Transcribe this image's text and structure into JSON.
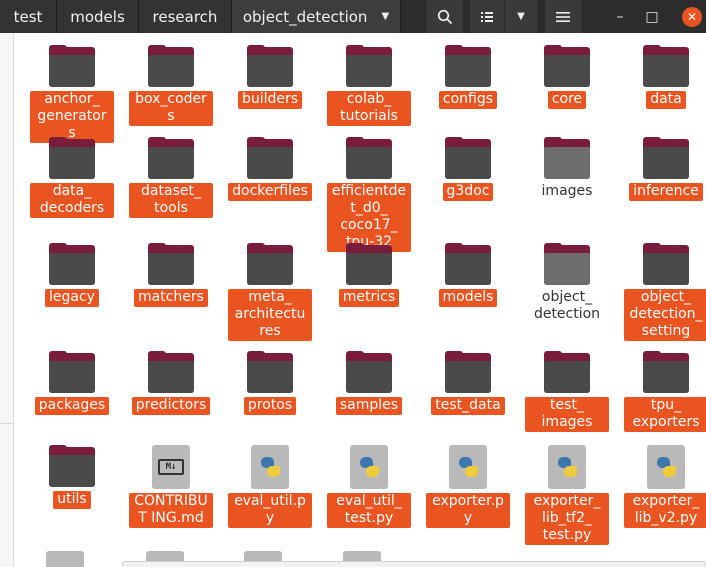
{
  "breadcrumbs": [
    "test",
    "models",
    "research",
    "object_detection"
  ],
  "toolbar": {
    "search_icon": "search-icon",
    "view_icon": "list-view-icon",
    "dropdown_icon": "chevron-down-icon",
    "menu_icon": "hamburger-menu-icon"
  },
  "window": {
    "minimize": "–",
    "maximize": "□",
    "close": "✕"
  },
  "colors": {
    "accent": "#e95420",
    "folder_back": "#7a1d3c",
    "folder_front": "#4a4a4a",
    "header": "#2c2c2c"
  },
  "items": [
    {
      "label": "anchor_ generators",
      "type": "folder",
      "selected": true
    },
    {
      "label": "box_coders",
      "type": "folder",
      "selected": true
    },
    {
      "label": "builders",
      "type": "folder",
      "selected": true
    },
    {
      "label": "colab_ tutorials",
      "type": "folder",
      "selected": true
    },
    {
      "label": "configs",
      "type": "folder",
      "selected": true
    },
    {
      "label": "core",
      "type": "folder",
      "selected": true
    },
    {
      "label": "data",
      "type": "folder",
      "selected": true
    },
    {
      "label": "data_ decoders",
      "type": "folder",
      "selected": true
    },
    {
      "label": "dataset_ tools",
      "type": "folder",
      "selected": true
    },
    {
      "label": "dockerfiles",
      "type": "folder",
      "selected": true
    },
    {
      "label": "efficientdet_d0_ coco17_ tpu-32",
      "type": "folder",
      "selected": true
    },
    {
      "label": "g3doc",
      "type": "folder",
      "selected": true
    },
    {
      "label": "images",
      "type": "folder-plain",
      "selected": false
    },
    {
      "label": "inference",
      "type": "folder",
      "selected": true
    },
    {
      "label": "legacy",
      "type": "folder",
      "selected": true
    },
    {
      "label": "matchers",
      "type": "folder",
      "selected": true
    },
    {
      "label": "meta_ architectures",
      "type": "folder",
      "selected": true
    },
    {
      "label": "metrics",
      "type": "folder",
      "selected": true
    },
    {
      "label": "models",
      "type": "folder",
      "selected": true
    },
    {
      "label": "object_ detection",
      "type": "folder-plain",
      "selected": false
    },
    {
      "label": "object_ detection_ setting",
      "type": "folder",
      "selected": true
    },
    {
      "label": "packages",
      "type": "folder",
      "selected": true
    },
    {
      "label": "predictors",
      "type": "folder",
      "selected": true
    },
    {
      "label": "protos",
      "type": "folder",
      "selected": true
    },
    {
      "label": "samples",
      "type": "folder",
      "selected": true
    },
    {
      "label": "test_data",
      "type": "folder",
      "selected": true
    },
    {
      "label": "test_ images",
      "type": "folder",
      "selected": true
    },
    {
      "label": "tpu_ exporters",
      "type": "folder",
      "selected": true
    },
    {
      "label": "utils",
      "type": "folder",
      "selected": true
    },
    {
      "label": "CONTRIBUT ING.md",
      "type": "md",
      "selected": true
    },
    {
      "label": "eval_util.py",
      "type": "py",
      "selected": true
    },
    {
      "label": "eval_util_ test.py",
      "type": "py",
      "selected": true
    },
    {
      "label": "exporter.py",
      "type": "py",
      "selected": true
    },
    {
      "label": "exporter_ lib_tf2_ test.py",
      "type": "py",
      "selected": true
    },
    {
      "label": "exporter_ lib_v2.py",
      "type": "py",
      "selected": true
    }
  ]
}
